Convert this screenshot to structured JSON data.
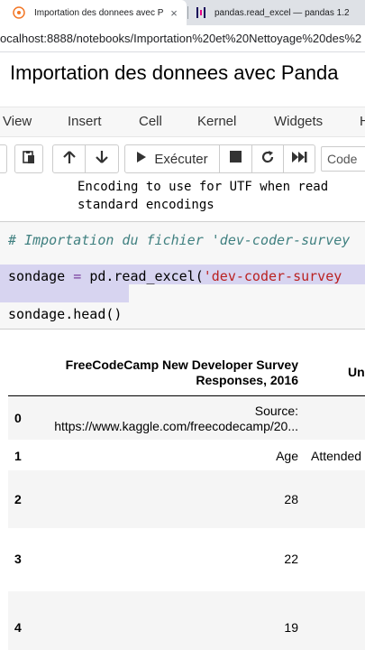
{
  "browser": {
    "tabs": [
      {
        "title": "Importation des donnees avec P",
        "close": "×"
      },
      {
        "title": "pandas.read_excel — pandas 1.2"
      }
    ],
    "url": "ocalhost:8888/notebooks/Importation%20et%20Nettoyage%20des%2"
  },
  "notebook": {
    "title": "Importation des donnees avec Panda"
  },
  "menubar": {
    "items": [
      "View",
      "Insert",
      "Cell",
      "Kernel",
      "Widgets",
      "H"
    ]
  },
  "toolbar": {
    "run_label": "Exécuter",
    "cell_type": "Code"
  },
  "help_output": {
    "line1": "Encoding to use for UTF when read",
    "line2": "standard encodings"
  },
  "code": {
    "comment": "# Importation du fichier 'dev-coder-survey",
    "line2_var": "sondage",
    "line2_op": " = ",
    "line2_call": "pd.read_excel(",
    "line2_str": "'dev-coder-survey",
    "line3": "sondage.head()"
  },
  "dataframe": {
    "columns": [
      "FreeCodeCamp New Developer Survey Responses, 2016",
      "Un"
    ],
    "rows": [
      {
        "index": "0",
        "c1": "Source: https://www.kaggle.com/freecodecamp/20...",
        "c2": ""
      },
      {
        "index": "1",
        "c1": "Age",
        "c2": "Attended"
      },
      {
        "index": "2",
        "c1": "28",
        "c2": ""
      },
      {
        "index": "3",
        "c1": "22",
        "c2": ""
      },
      {
        "index": "4",
        "c1": "19",
        "c2": ""
      }
    ]
  },
  "colors": {
    "comment": "#408080",
    "keyword": "#7a3e9d",
    "string": "#ba2121",
    "selection": "#d7d4f0"
  }
}
